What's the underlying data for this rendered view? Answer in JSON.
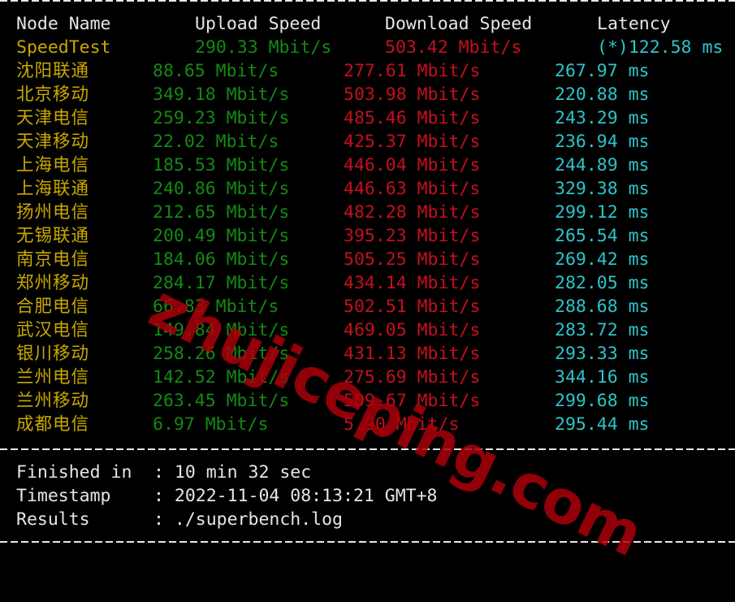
{
  "header": {
    "node_name": "Node Name",
    "upload_speed": "Upload Speed",
    "download_speed": "Download Speed",
    "latency": "Latency"
  },
  "speedtest": {
    "name": "SpeedTest",
    "upload": "290.33 Mbit/s",
    "download": "503.42 Mbit/s",
    "latency": "(*)122.58 ms"
  },
  "rows": [
    {
      "name": "沈阳联通",
      "upload": "88.65 Mbit/s",
      "download": "277.61 Mbit/s",
      "latency": "267.97 ms"
    },
    {
      "name": "北京移动",
      "upload": "349.18 Mbit/s",
      "download": "503.98 Mbit/s",
      "latency": "220.88 ms"
    },
    {
      "name": "天津电信",
      "upload": "259.23 Mbit/s",
      "download": "485.46 Mbit/s",
      "latency": "243.29 ms"
    },
    {
      "name": "天津移动",
      "upload": "22.02 Mbit/s",
      "download": "425.37 Mbit/s",
      "latency": "236.94 ms"
    },
    {
      "name": "上海电信",
      "upload": "185.53 Mbit/s",
      "download": "446.04 Mbit/s",
      "latency": "244.89 ms"
    },
    {
      "name": "上海联通",
      "upload": "240.86 Mbit/s",
      "download": "446.63 Mbit/s",
      "latency": "329.38 ms"
    },
    {
      "name": "扬州电信",
      "upload": "212.65 Mbit/s",
      "download": "482.28 Mbit/s",
      "latency": "299.12 ms"
    },
    {
      "name": "无锡联通",
      "upload": "200.49 Mbit/s",
      "download": "395.23 Mbit/s",
      "latency": "265.54 ms"
    },
    {
      "name": "南京电信",
      "upload": "184.06 Mbit/s",
      "download": "505.25 Mbit/s",
      "latency": "269.42 ms"
    },
    {
      "name": "郑州移动",
      "upload": "284.17 Mbit/s",
      "download": "434.14 Mbit/s",
      "latency": "282.05 ms"
    },
    {
      "name": "合肥电信",
      "upload": "66.83 Mbit/s",
      "download": "502.51 Mbit/s",
      "latency": "288.68 ms"
    },
    {
      "name": "武汉电信",
      "upload": "149.84 Mbit/s",
      "download": "469.05 Mbit/s",
      "latency": "283.72 ms"
    },
    {
      "name": "银川移动",
      "upload": "258.26 Mbit/s",
      "download": "431.13 Mbit/s",
      "latency": "293.33 ms"
    },
    {
      "name": "兰州电信",
      "upload": "142.52 Mbit/s",
      "download": "275.69 Mbit/s",
      "latency": "344.16 ms"
    },
    {
      "name": "兰州移动",
      "upload": "263.45 Mbit/s",
      "download": "509.67 Mbit/s",
      "latency": "299.68 ms"
    },
    {
      "name": "成都电信",
      "upload": "6.97 Mbit/s",
      "download": "5.90 Mbit/s",
      "latency": "295.44 ms"
    }
  ],
  "summary": {
    "finished_label": "Finished in",
    "finished_value": ": 10 min 32 sec",
    "timestamp_label": "Timestamp",
    "timestamp_value": ": 2022-11-04 08:13:21 GMT+8",
    "results_label": "Results",
    "results_value": ": ./superbench.log"
  },
  "watermark": "zhujiceping.com",
  "colors": {
    "background": "#000000",
    "header_text": "#e6e6e6",
    "node_name": "#c8a800",
    "upload": "#138a13",
    "download": "#c50f1f",
    "latency": "#2cc5c9",
    "watermark": "#aa000a"
  }
}
